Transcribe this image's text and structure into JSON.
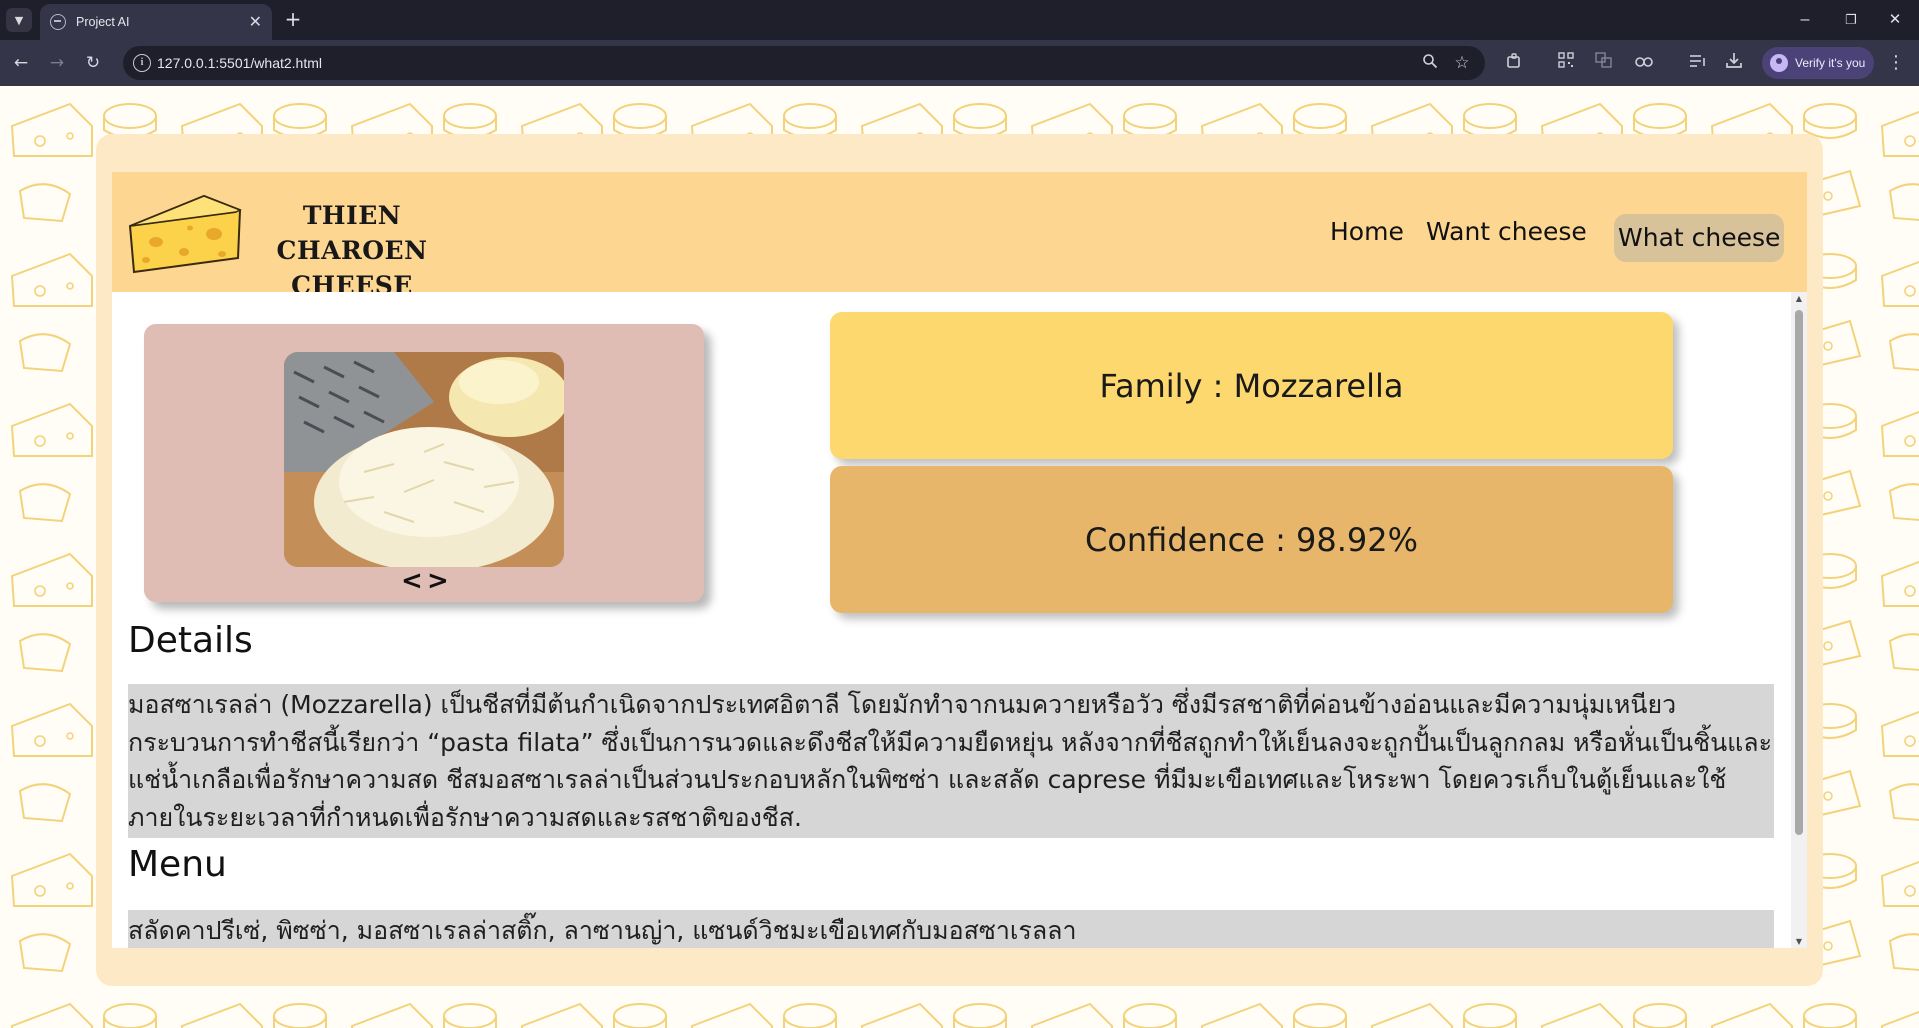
{
  "browser": {
    "tab_title": "Project AI",
    "url": "127.0.0.1:5501/what2.html",
    "verify_label": "Verify it's you",
    "new_tab_symbol": "+",
    "close_symbol": "✕",
    "minimize_symbol": "–",
    "restore_symbol": "❐",
    "window_close_symbol": "✕"
  },
  "site": {
    "logo_line1": "THIEN CHAROEN",
    "logo_line2": "CHEESE",
    "nav": [
      "Home",
      "Want cheese",
      "What cheese"
    ],
    "active_nav": "What cheese"
  },
  "result": {
    "family_label": "Family : Mozzarella",
    "confidence_label": "Confidence : 98.92%",
    "prev_symbol": "<",
    "next_symbol": ">"
  },
  "details": {
    "heading": "Details",
    "text": "มอสซาเรลล่า (Mozzarella) เป็นชีสที่มีต้นกำเนิดจากประเทศอิตาลี โดยมักทำจากนมควายหรือวัว ซึ่งมีรสชาติที่ค่อนข้างอ่อนและมีความนุ่มเหนียว กระบวนการทำชีสนี้เรียกว่า “pasta filata” ซึ่งเป็นการนวดและดึงชีสให้มีความยืดหยุ่น หลังจากที่ชีสถูกทำให้เย็นลงจะถูกปั้นเป็นลูกกลม หรือหั่นเป็นชิ้นและแช่น้ำเกลือเพื่อรักษาความสด ชีสมอสซาเรลล่าเป็นส่วนประกอบหลักในพิซซ่า และสลัด caprese ที่มีมะเขือเทศและโหระพา โดยควรเก็บในตู้เย็นและใช้ภายในระยะเวลาที่กำหนดเพื่อรักษาความสดและรสชาติของชีส."
  },
  "menu": {
    "heading": "Menu",
    "text": "สลัดคาปรีเซ่, พิซซ่า, มอสซาเรลล่าสติ๊ก, ลาซานญ่า, แซนด์วิชมะเขือเทศกับมอสซาเรลลา"
  },
  "colors": {
    "header": "#fdd692",
    "frame": "#fde9c6",
    "family_card": "#fcd86e",
    "confidence_card": "#e8b66a",
    "image_card": "#dfbcb4",
    "text_highlight": "#d6d6d6",
    "active_nav": "#d8c29a"
  },
  "icons": [
    "tab-search-icon",
    "globe-icon",
    "back-arrow-icon",
    "forward-arrow-icon",
    "reload-icon",
    "site-info-icon",
    "zoom-icon",
    "bookmark-star-icon",
    "extensions-icon",
    "qr-code-icon",
    "translate-icon",
    "link-icon",
    "reading-list-icon",
    "download-icon",
    "profile-avatar-icon",
    "menu-kebab-icon",
    "cheese-logo-icon"
  ]
}
